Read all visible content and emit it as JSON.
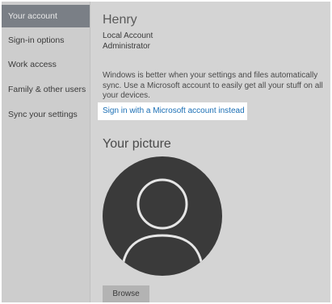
{
  "sidebar": {
    "items": [
      {
        "label": "Your account",
        "active": true
      },
      {
        "label": "Sign-in options",
        "active": false
      },
      {
        "label": "Work access",
        "active": false
      },
      {
        "label": "Family & other users",
        "active": false
      },
      {
        "label": "Sync your settings",
        "active": false
      }
    ]
  },
  "account": {
    "name": "Henry",
    "type": "Local Account",
    "role": "Administrator"
  },
  "sync_message": "Windows is better when your settings and files automatically sync. Use a Microsoft account to easily get all your stuff on all your devices.",
  "ms_link": "Sign in with a Microsoft account instead",
  "picture": {
    "heading": "Your picture",
    "avatar_icon": "default-user-avatar-icon",
    "browse_label": "Browse"
  },
  "colors": {
    "sidebar_active_bg": "#7a7f86",
    "link": "#1b6fb5",
    "avatar": "#3a3a3a"
  }
}
